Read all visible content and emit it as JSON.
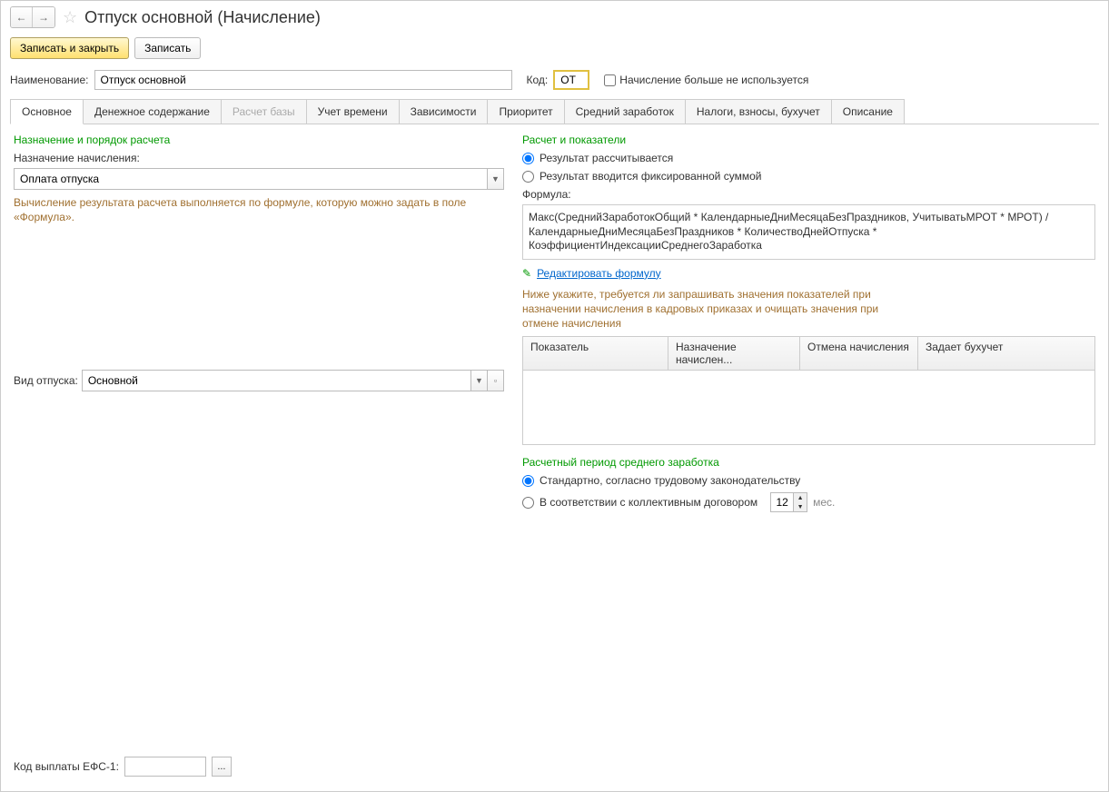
{
  "title": "Отпуск основной (Начисление)",
  "toolbar": {
    "save_close": "Записать и закрыть",
    "save": "Записать"
  },
  "fields": {
    "name_label": "Наименование:",
    "name_value": "Отпуск основной",
    "code_label": "Код:",
    "code_value": "ОТ",
    "not_used_label": "Начисление больше не используется"
  },
  "tabs": [
    "Основное",
    "Денежное содержание",
    "Расчет базы",
    "Учет времени",
    "Зависимости",
    "Приоритет",
    "Средний заработок",
    "Налоги, взносы, бухучет",
    "Описание"
  ],
  "left": {
    "section1_title": "Назначение и порядок расчета",
    "purpose_label": "Назначение начисления:",
    "purpose_value": "Оплата отпуска",
    "hint": "Вычисление результата расчета выполняется по формуле, которую можно задать в поле «Формула».",
    "vac_type_label": "Вид отпуска:",
    "vac_type_value": "Основной"
  },
  "right": {
    "section_title": "Расчет и показатели",
    "radio_calc": "Результат рассчитывается",
    "radio_fixed": "Результат вводится фиксированной суммой",
    "formula_label": "Формула:",
    "formula_text": "Макс(СреднийЗаработокОбщий * КалендарныеДниМесяцаБезПраздников, УчитыватьМРОТ * МРОТ) / КалендарныеДниМесяцаБезПраздников * КоличествоДнейОтпуска * КоэффициентИндексацииСреднегоЗаработка",
    "edit_formula": "Редактировать формулу",
    "hint2": "Ниже укажите, требуется ли запрашивать значения показателей при назначении начисления в кадровых приказах и очищать значения при отмене начисления",
    "table_headers": [
      "Показатель",
      "Назначение начислен...",
      "Отмена начисления",
      "Задает бухучет"
    ],
    "period_title": "Расчетный период среднего заработка",
    "radio_std": "Стандартно, согласно трудовому законодательству",
    "radio_coll": "В соответствии с коллективным договором",
    "months_value": "12",
    "months_suffix": "мес."
  },
  "bottom": {
    "efs_label": "Код выплаты ЕФС-1:"
  }
}
